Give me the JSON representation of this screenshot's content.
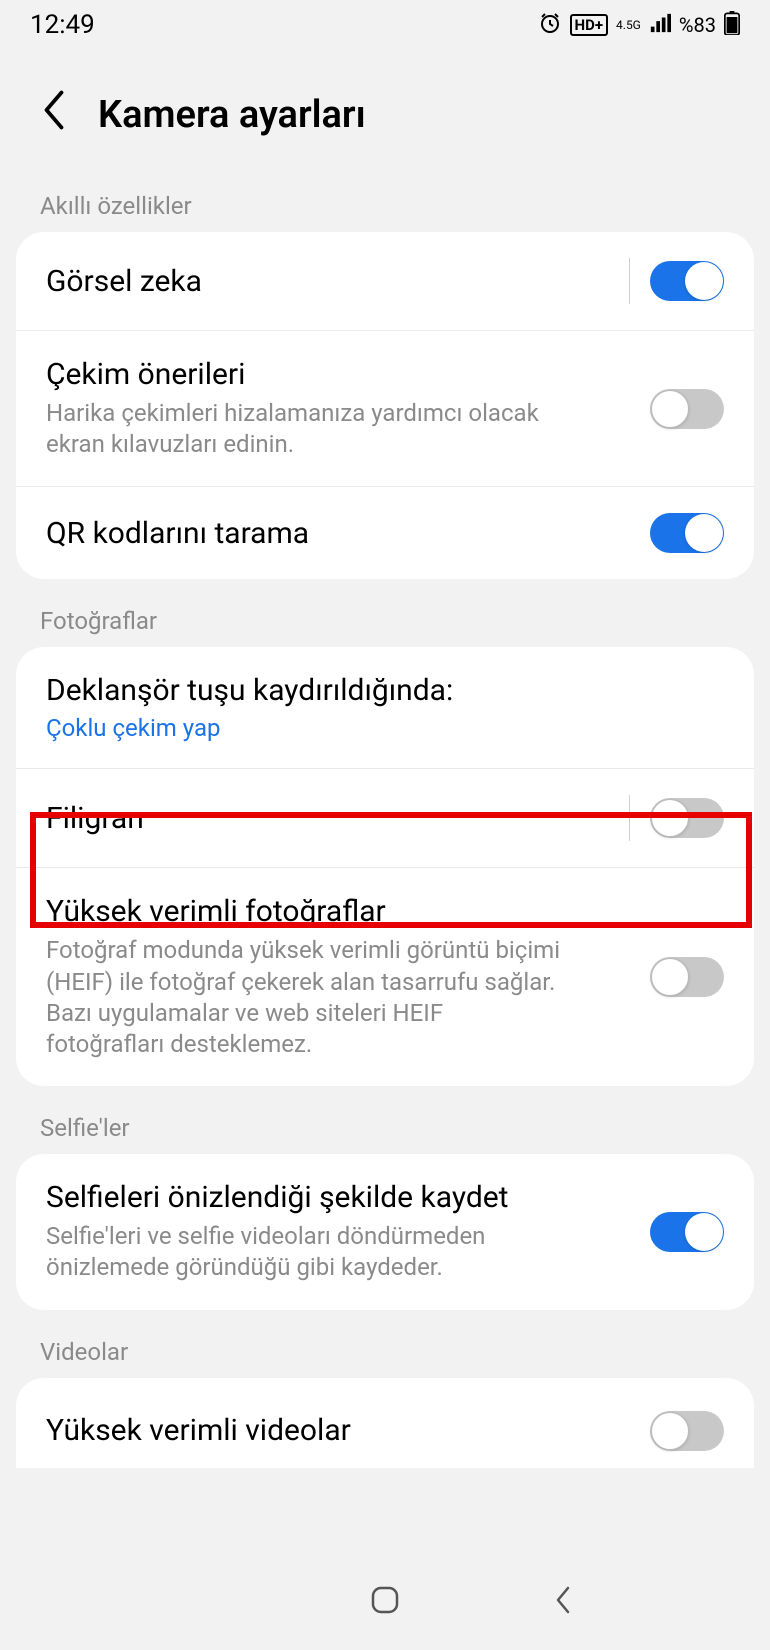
{
  "statusbar": {
    "time": "12:49",
    "battery": "%83",
    "network": "4.5G"
  },
  "header": {
    "title": "Kamera ayarları"
  },
  "sections": {
    "smart": {
      "label": "Akıllı özellikler",
      "scene": {
        "title": "Görsel zeka"
      },
      "shot": {
        "title": "Çekim önerileri",
        "sub": "Harika çekimleri hizalamanıza yardımcı olacak ekran kılavuzları edinin."
      },
      "qr": {
        "title": "QR kodlarını tarama"
      }
    },
    "photos": {
      "label": "Fotoğraflar",
      "shutter": {
        "title": "Deklanşör tuşu kaydırıldığında:",
        "link": "Çoklu çekim yap"
      },
      "watermark": {
        "title": "Filigran"
      },
      "heif": {
        "title": "Yüksek verimli fotoğraflar",
        "sub": "Fotoğraf modunda yüksek verimli görüntü biçimi (HEIF) ile fotoğraf çekerek alan tasarrufu sağlar. Bazı uygulamalar ve web siteleri HEIF fotoğrafları desteklemez."
      }
    },
    "selfies": {
      "label": "Selfie'ler",
      "save": {
        "title": "Selfieleri önizlendiği şekilde kaydet",
        "sub": "Selfie'leri ve selfie videoları döndürmeden önizlemede göründüğü gibi kaydeder."
      }
    },
    "videos": {
      "label": "Videolar",
      "hevc": {
        "title": "Yüksek verimli videolar"
      }
    }
  }
}
